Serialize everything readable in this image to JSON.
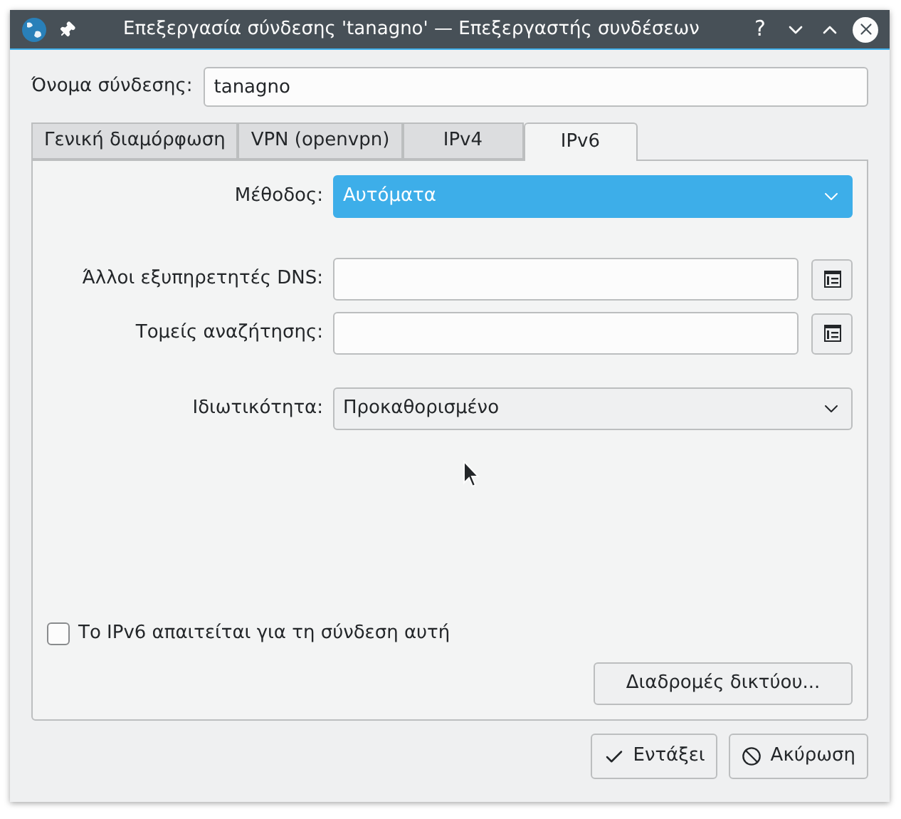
{
  "window": {
    "title": "Επεξεργασία σύνδεσης 'tanagno' — Επεξεργαστής συνδέσεων",
    "title_buttons": [
      "?"
    ]
  },
  "connection_name": {
    "label": "Όνομα σύνδεσης:",
    "value": "tanagno"
  },
  "tabs": [
    {
      "label": "Γενική διαμόρφωση",
      "selected": false
    },
    {
      "label": "VPN (openvpn)",
      "selected": false
    },
    {
      "label": "IPv4",
      "selected": false
    },
    {
      "label": "IPv6",
      "selected": true
    }
  ],
  "sections": [
    [
      {
        "kind": "combo",
        "label": "Μέθοδος:",
        "value": "Αυτόματα",
        "highlighted": true
      }
    ],
    [
      {
        "kind": "text-list",
        "label": "Άλλοι εξυπηρετητές DNS:"
      },
      {
        "kind": "text-list",
        "label": "Τομείς αναζήτησης:"
      }
    ],
    [
      {
        "kind": "combo",
        "label": "Ιδιωτικότητα:",
        "value": "Προκαθορισμένο",
        "highlighted": false
      }
    ]
  ],
  "required_checkbox": {
    "label": "Το IPv6 απαιτείται για τη σύνδεση αυτή",
    "checked": false
  },
  "routes_button": "Διαδρομές δικτύου...",
  "buttons": [
    {
      "kind": "ok",
      "label": "Εντάξει"
    },
    {
      "kind": "cancel",
      "label": "Ακύρωση"
    }
  ]
}
